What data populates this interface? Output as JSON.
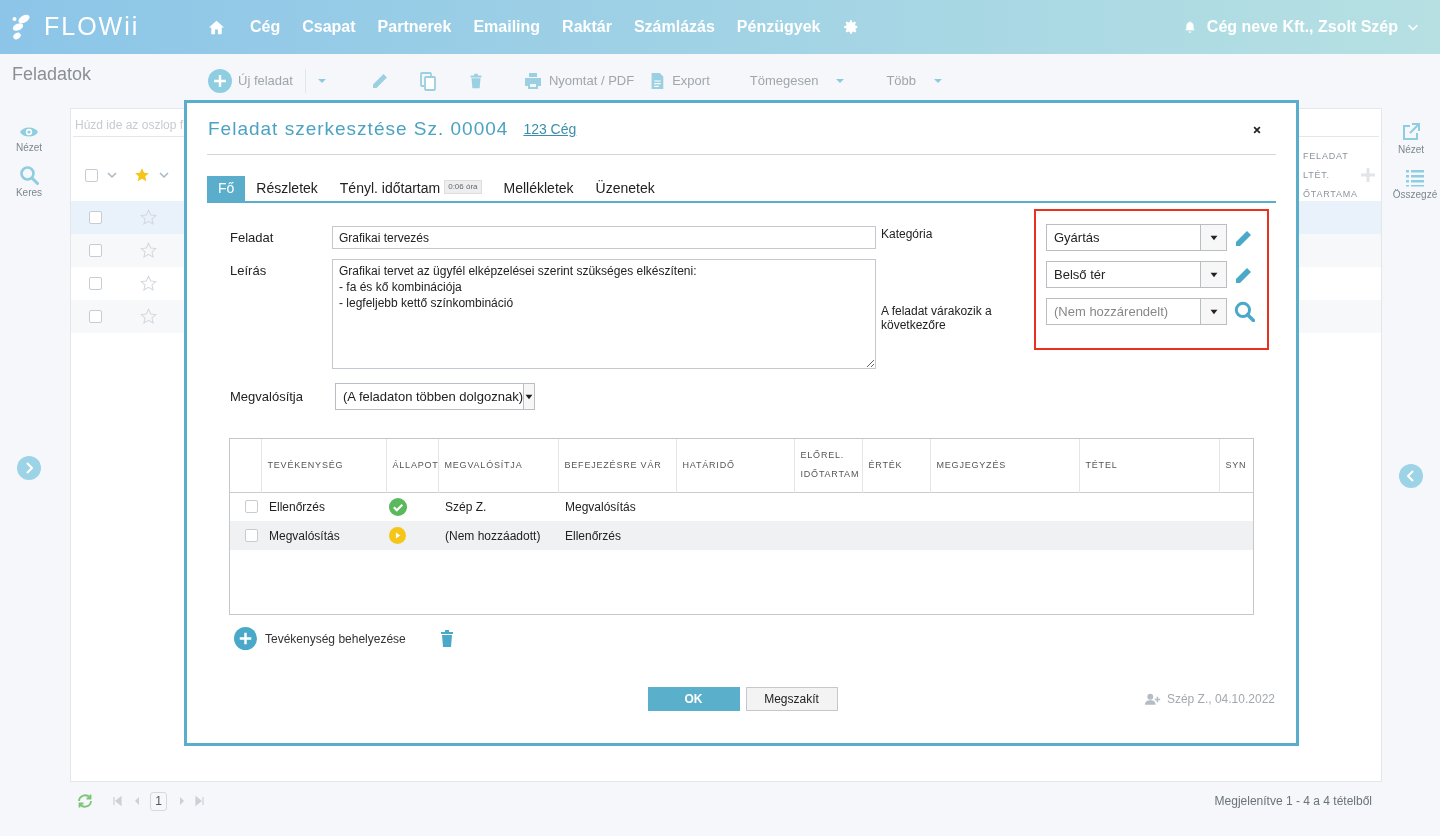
{
  "app": {
    "logo": "FLOWii"
  },
  "nav": [
    {
      "kind": "home"
    },
    {
      "kind": "link",
      "label": "Cég"
    },
    {
      "kind": "link",
      "label": "Csapat"
    },
    {
      "kind": "link",
      "label": "Partnerek"
    },
    {
      "kind": "link",
      "label": "Emailing"
    },
    {
      "kind": "link",
      "label": "Raktár"
    },
    {
      "kind": "link",
      "label": "Számlázás"
    },
    {
      "kind": "link",
      "label": "Pénzügyek"
    },
    {
      "kind": "settings"
    }
  ],
  "user": {
    "name": "Cég neve Kft., Zsolt Szép"
  },
  "page_title": "Feladatok",
  "toolbar": [
    {
      "kind": "add",
      "label": "Új feladat"
    },
    {
      "kind": "split"
    },
    {
      "kind": "edit"
    },
    {
      "kind": "copy"
    },
    {
      "kind": "delete"
    },
    {
      "kind": "print",
      "label": "Nyomtat / PDF"
    },
    {
      "kind": "export",
      "label": "Export"
    },
    {
      "kind": "menu",
      "label": "Tömegesen"
    },
    {
      "kind": "menu",
      "label": "Több"
    }
  ],
  "left_sidebar": [
    {
      "kind": "view",
      "label": "Nézet"
    },
    {
      "kind": "search",
      "label": "Keres"
    }
  ],
  "right_sidebar": [
    {
      "kind": "external",
      "label": "Nézet"
    },
    {
      "kind": "list",
      "label": "Összegzé"
    }
  ],
  "grid": {
    "all_checked": false,
    "group_hint": "Húzd ide az oszlop f",
    "header_right": [
      "FELADAT",
      "LTÉT.",
      "ŐTARTAMA"
    ],
    "rows": [
      {
        "selected": true,
        "checked": false
      },
      {
        "selected": false,
        "checked": false
      },
      {
        "selected": false,
        "checked": false
      },
      {
        "selected": false,
        "checked": false
      }
    ]
  },
  "pager": {
    "page": "1",
    "summary": "Megjelenítve 1 - 4 a 4 tételből"
  },
  "modal": {
    "title": "Feladat szerkesztése Sz. 00004",
    "link": "123 Cég",
    "tabs": [
      {
        "label": "Fő",
        "selected": true
      },
      {
        "label": "Részletek",
        "selected": false
      },
      {
        "label": "Tényl. időtartam",
        "badge": "0:06 óra",
        "selected": false
      },
      {
        "label": "Mellékletek",
        "selected": false
      },
      {
        "label": "Üzenetek",
        "selected": false
      }
    ],
    "task": {
      "label": "Feladat",
      "value": "Grafikai tervezés"
    },
    "description": {
      "label": "Leírás",
      "value": "Grafikai tervet az ügyfél elképzelései szerint szükséges elkészíteni:\n- fa és kő kombinációja\n- legfeljebb kettő színkombináció"
    },
    "side_fields": [
      {
        "kind": "edit",
        "label": "Kategória",
        "value": "Gyártás"
      },
      {
        "kind": "edit",
        "value": "Belső tér"
      },
      {
        "kind": "search",
        "label": "A feladat várakozik a következőre",
        "placeholder": "(Nem hozzárendelt)"
      }
    ],
    "assignee": {
      "label": "Megvalósítja",
      "value": "(A feladaton többen dolgoznak)"
    },
    "activities": {
      "columns": [
        "TEVÉKENYSÉG",
        "ÁLLAPOT",
        "MEGVALÓSÍTJA",
        "BEFEJEZÉSRE VÁR",
        "HATÁRIDŐ",
        "ELŐREL. IDŐTARTAM",
        "ÉRTÉK",
        "MEGJEGYZÉS",
        "TÉTEL",
        "SYN"
      ],
      "rows": [
        {
          "kind": "done",
          "selected": false,
          "checked": false,
          "activity": "Ellenőrzés",
          "assignee": "Szép Z.",
          "waits_for": "Megvalósítás"
        },
        {
          "kind": "in_progress",
          "selected": true,
          "checked": false,
          "activity": "Megvalósítás",
          "assignee": "(Nem hozzáadott)",
          "waits_for": "Ellenőrzés"
        }
      ]
    },
    "add_activity": "Tevékenység behelyezése",
    "buttons": [
      {
        "kind": "primary",
        "label": "OK"
      },
      {
        "kind": "secondary",
        "label": "Megszakít"
      }
    ],
    "created": "Szép Z., 04.10.2022"
  }
}
